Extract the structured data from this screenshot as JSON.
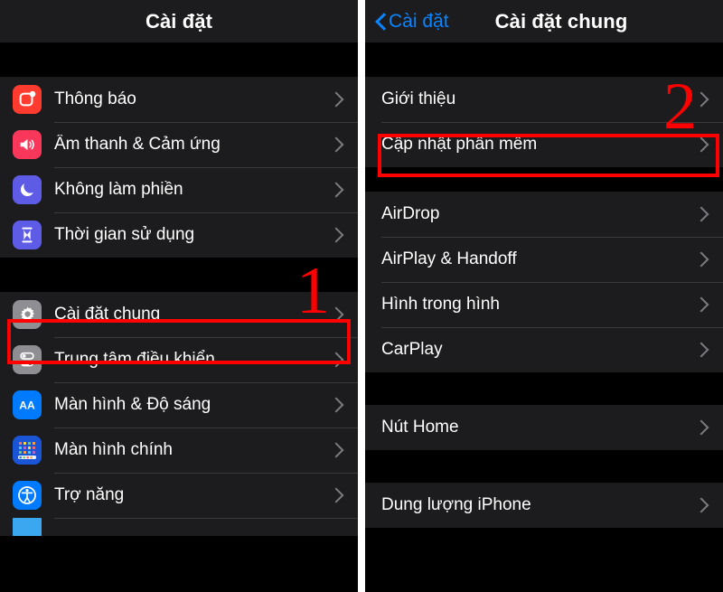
{
  "left_panel": {
    "nav": {
      "title": "Cài đặt"
    },
    "sections": [
      {
        "rows": [
          {
            "label": "Thông báo",
            "icon": "notifications-icon",
            "icon_bg": "#ff3b30"
          },
          {
            "label": "Âm thanh & Cảm ứng",
            "icon": "sounds-haptics-icon",
            "icon_bg": "#f8375b"
          },
          {
            "label": "Không làm phiền",
            "icon": "do-not-disturb-icon",
            "icon_bg": "#5e5ce6"
          },
          {
            "label": "Thời gian sử dụng",
            "icon": "screen-time-icon",
            "icon_bg": "#5e5ce6"
          }
        ]
      },
      {
        "rows": [
          {
            "label": "Cài đặt chung",
            "icon": "general-gear-icon",
            "icon_bg": "#8e8e93"
          },
          {
            "label": "Trung tâm điều khiển",
            "icon": "control-center-icon",
            "icon_bg": "#8e8e93"
          },
          {
            "label": "Màn hình & Độ sáng",
            "icon": "display-brightness-icon",
            "icon_bg": "#007aff"
          },
          {
            "label": "Màn hình chính",
            "icon": "home-screen-icon",
            "icon_bg": "#1a55d6"
          },
          {
            "label": "Trợ năng",
            "icon": "accessibility-icon",
            "icon_bg": "#007aff"
          }
        ]
      }
    ]
  },
  "right_panel": {
    "nav": {
      "back_label": "Cài đặt",
      "title": "Cài đặt chung"
    },
    "sections": [
      {
        "rows": [
          {
            "label": "Giới thiệu"
          },
          {
            "label": "Cập nhật phần mềm"
          }
        ]
      },
      {
        "rows": [
          {
            "label": "AirDrop"
          },
          {
            "label": "AirPlay & Handoff"
          },
          {
            "label": "Hình trong hình"
          },
          {
            "label": "CarPlay"
          }
        ]
      },
      {
        "rows": [
          {
            "label": "Nút Home"
          }
        ]
      },
      {
        "rows": [
          {
            "label": "Dung lượng iPhone"
          }
        ]
      }
    ]
  },
  "annotations": {
    "color": "#ff0000",
    "step_one": {
      "number": "1",
      "highlights_row": "Cài đặt chung"
    },
    "step_two": {
      "number": "2",
      "highlights_row": "Cập nhật phần mềm"
    }
  }
}
